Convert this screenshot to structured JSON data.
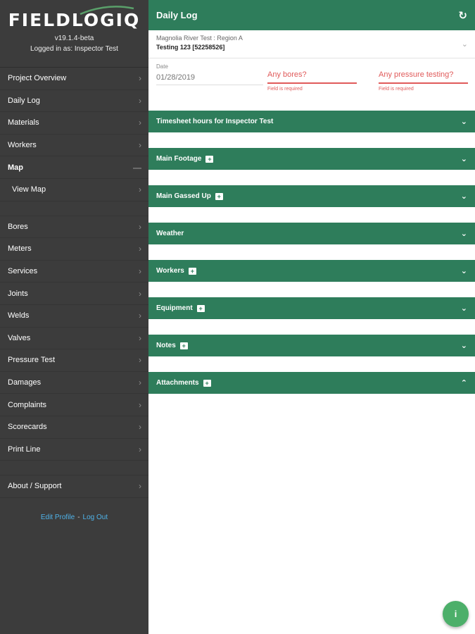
{
  "app": {
    "logo_part1": "FIELD",
    "logo_part2": "LOGIQ",
    "version": "v19.1.4-beta",
    "logged_in": "Logged in as: Inspector Test"
  },
  "sidebar": {
    "group1": [
      {
        "label": "Project Overview"
      },
      {
        "label": "Daily Log"
      },
      {
        "label": "Materials"
      },
      {
        "label": "Workers"
      }
    ],
    "map": {
      "label": "Map",
      "sub": "View Map"
    },
    "group2": [
      {
        "label": "Bores"
      },
      {
        "label": "Meters"
      },
      {
        "label": "Services"
      },
      {
        "label": "Joints"
      },
      {
        "label": "Welds"
      },
      {
        "label": "Valves"
      },
      {
        "label": "Pressure Test"
      },
      {
        "label": "Damages"
      },
      {
        "label": "Complaints"
      },
      {
        "label": "Scorecards"
      },
      {
        "label": "Print Line"
      }
    ],
    "about": "About / Support",
    "edit_profile": "Edit Profile",
    "separator": "-",
    "logout": "Log Out"
  },
  "header": {
    "title": "Daily Log"
  },
  "project": {
    "line1": "Magnolia River Test : Region A",
    "line2": "Testing 123 [52258526]"
  },
  "form": {
    "date_label": "Date",
    "date_value": "01/28/2019",
    "bores_placeholder": "Any bores?",
    "bores_error": "Field is required",
    "pressure_placeholder": "Any pressure testing?",
    "pressure_error": "Field is required"
  },
  "sections": [
    {
      "label": "Timesheet hours for Inspector Test",
      "plus": false,
      "caret": "down"
    },
    {
      "label": "Main Footage",
      "plus": true,
      "caret": "down"
    },
    {
      "label": "Main Gassed Up",
      "plus": true,
      "caret": "down"
    },
    {
      "label": "Weather",
      "plus": false,
      "caret": "down"
    },
    {
      "label": "Workers",
      "plus": true,
      "caret": "down"
    },
    {
      "label": "Equipment",
      "plus": true,
      "caret": "down"
    },
    {
      "label": "Notes",
      "plus": true,
      "caret": "down"
    },
    {
      "label": "Attachments",
      "plus": true,
      "caret": "up"
    }
  ],
  "fab": {
    "label": "i"
  },
  "colors": {
    "sidebar_bg": "#3c3c3c",
    "header_green": "#2e7d5b",
    "error_red": "#e05a5a",
    "link_blue": "#4fb2e8",
    "fab_green": "#4caf6a"
  }
}
